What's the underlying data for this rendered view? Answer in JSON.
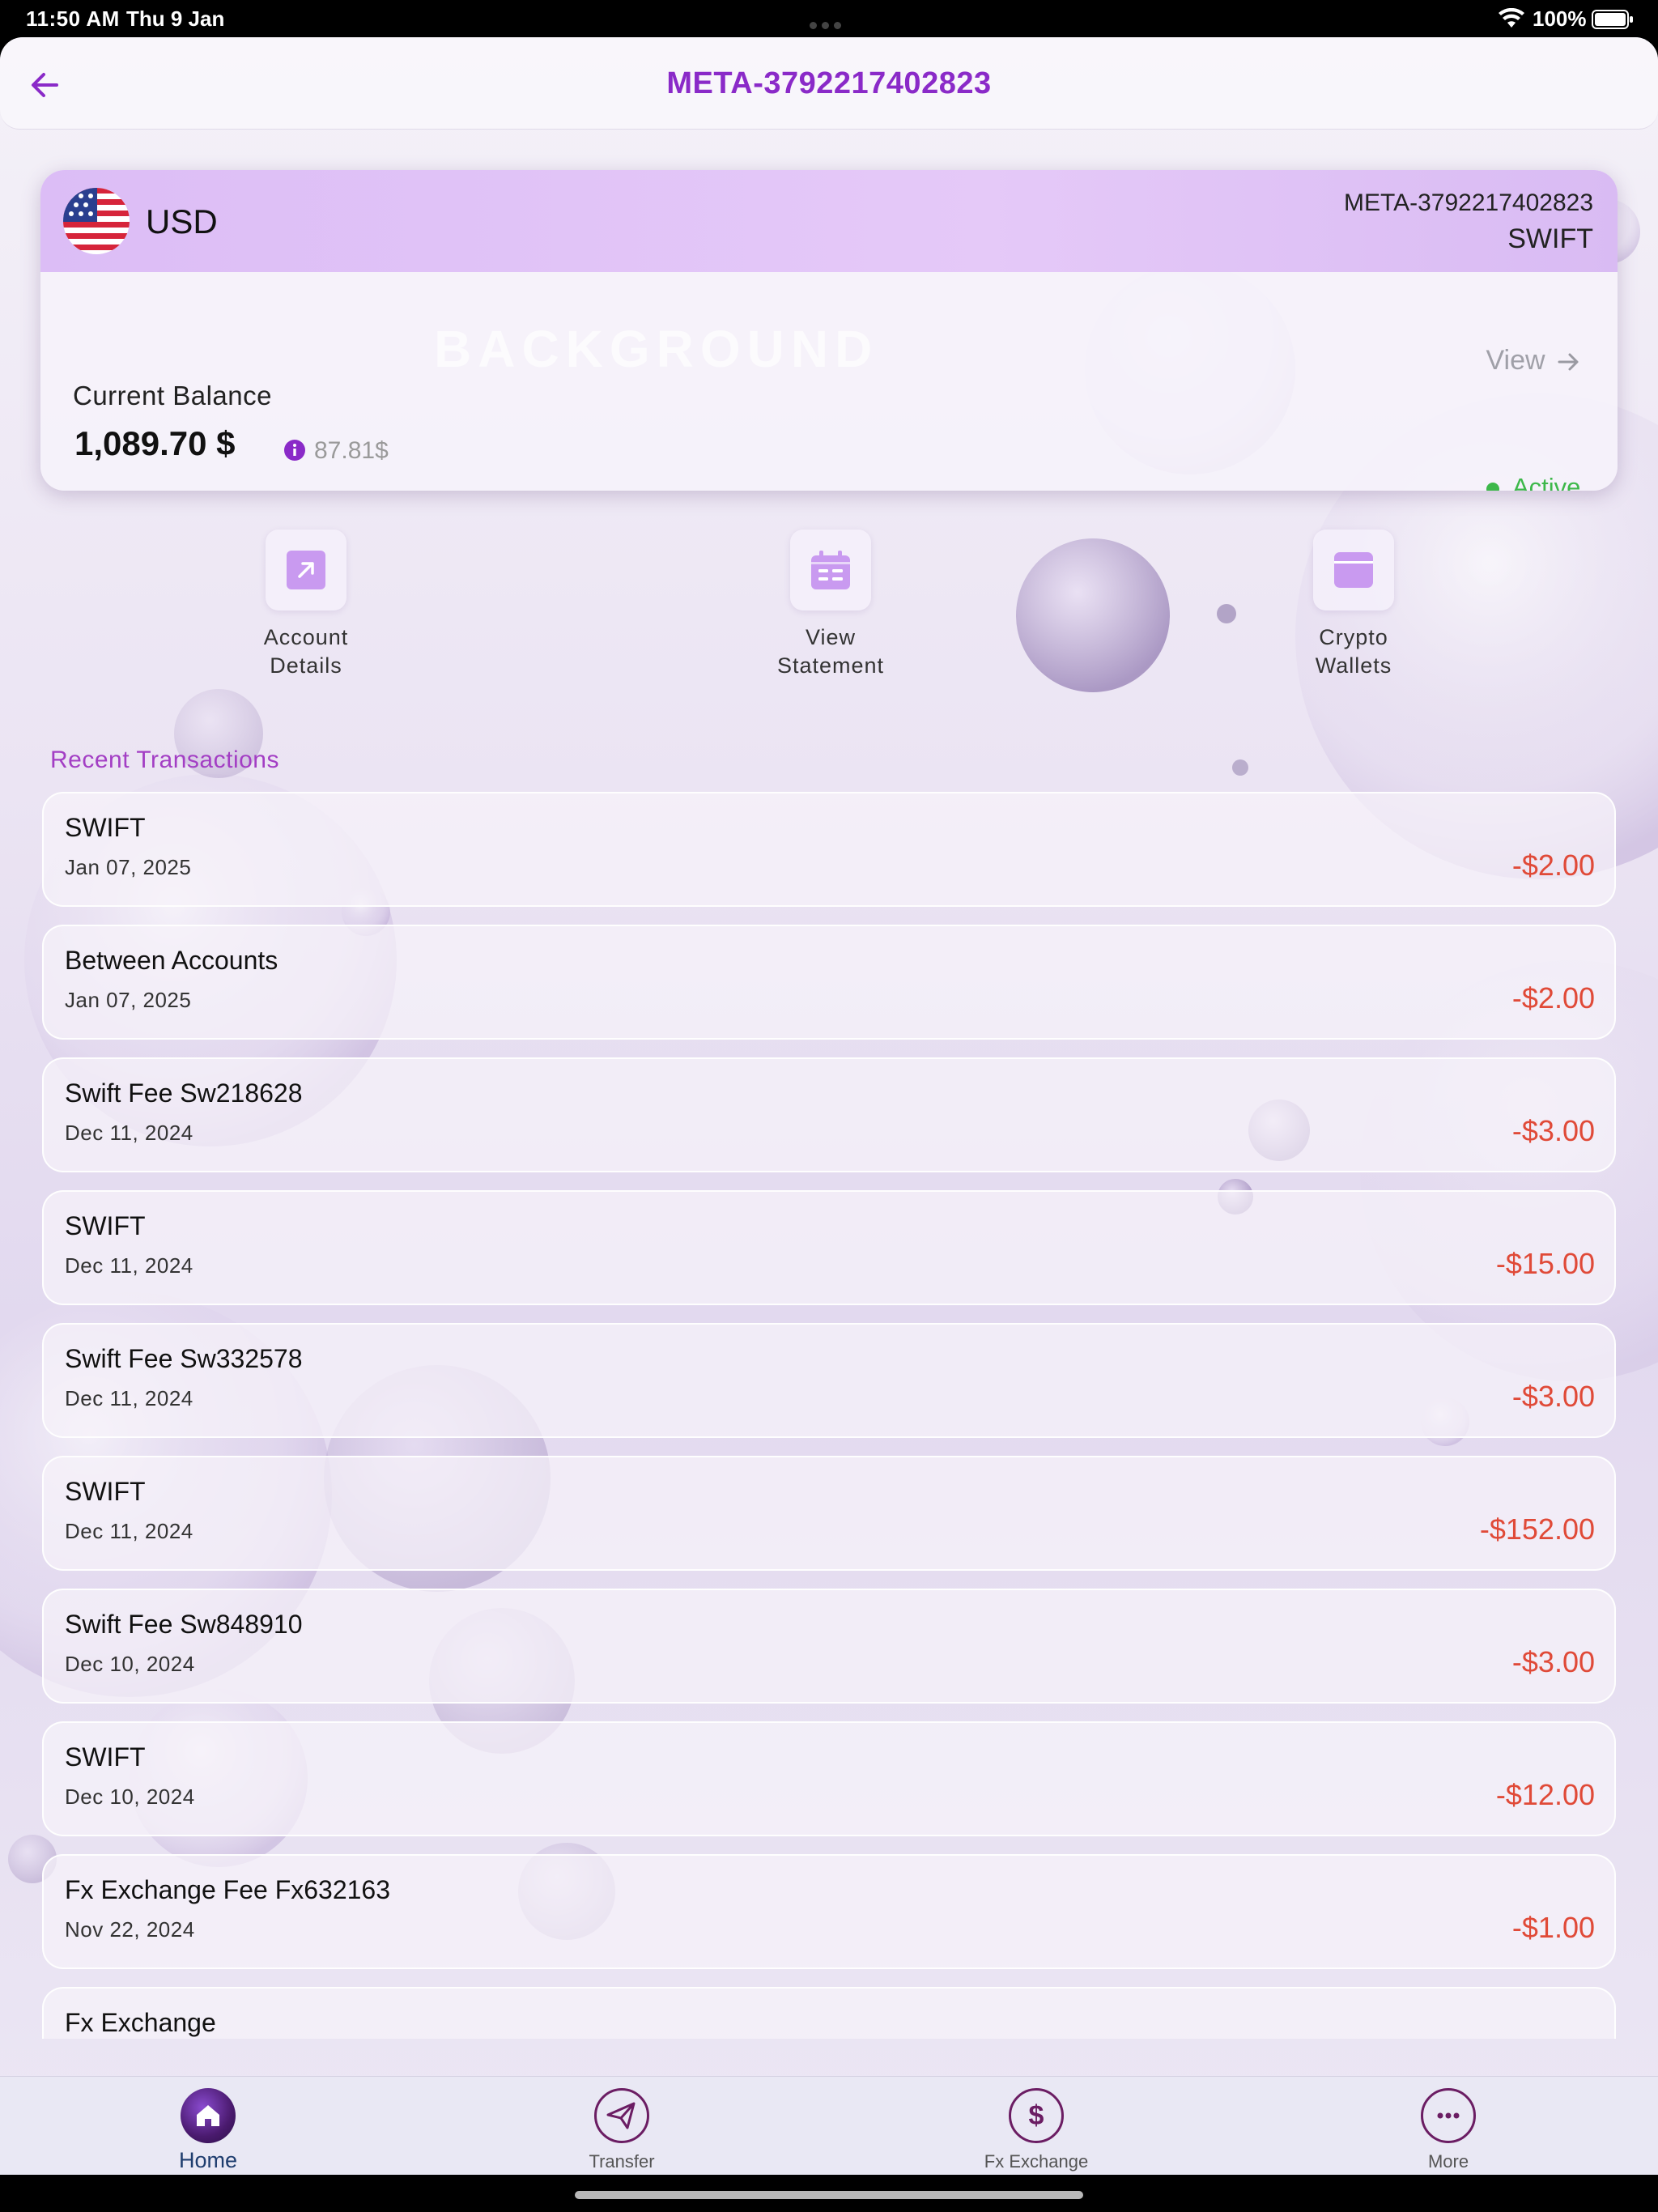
{
  "status_bar": {
    "time": "11:50 AM",
    "date": "Thu 9 Jan",
    "battery": "100%"
  },
  "header": {
    "title": "META-3792217402823"
  },
  "account_card": {
    "currency": "USD",
    "account_number": "META-3792217402823",
    "network": "SWIFT",
    "watermark": "BACKGROUND",
    "balance_label": "Current Balance",
    "balance_value": "1,089.70 $",
    "secondary_amount": "87.81$",
    "view_label": "View",
    "status": "Active",
    "status_color": "#3db84a",
    "header_color": "#e0c4f7"
  },
  "actions": [
    {
      "line1": "Account",
      "line2": "Details",
      "icon": "arrow-up-right-icon"
    },
    {
      "line1": "View",
      "line2": "Statement",
      "icon": "calendar-icon"
    },
    {
      "line1": "Crypto",
      "line2": "Wallets",
      "icon": "wallet-icon"
    }
  ],
  "recent": {
    "title": "Recent Transactions",
    "transactions": [
      {
        "name": "SWIFT",
        "date": "Jan 07, 2025",
        "amount": "-$2.00"
      },
      {
        "name": "Between Accounts",
        "date": "Jan 07, 2025",
        "amount": "-$2.00"
      },
      {
        "name": "Swift Fee Sw218628",
        "date": "Dec 11, 2024",
        "amount": "-$3.00"
      },
      {
        "name": "SWIFT",
        "date": "Dec 11, 2024",
        "amount": "-$15.00"
      },
      {
        "name": "Swift Fee Sw332578",
        "date": "Dec 11, 2024",
        "amount": "-$3.00"
      },
      {
        "name": "SWIFT",
        "date": "Dec 11, 2024",
        "amount": "-$152.00"
      },
      {
        "name": "Swift Fee Sw848910",
        "date": "Dec 10, 2024",
        "amount": "-$3.00"
      },
      {
        "name": "SWIFT",
        "date": "Dec 10, 2024",
        "amount": "-$12.00"
      },
      {
        "name": "Fx Exchange Fee Fx632163",
        "date": "Nov 22, 2024",
        "amount": "-$1.00"
      },
      {
        "name": "Fx Exchange",
        "date": "",
        "amount": ""
      }
    ]
  },
  "tab_bar": {
    "tabs": [
      {
        "label": "Home",
        "icon": "home-icon",
        "active": true
      },
      {
        "label": "Transfer",
        "icon": "paper-plane-icon",
        "active": false
      },
      {
        "label": "Fx Exchange",
        "icon": "dollar-icon",
        "active": false
      },
      {
        "label": "More",
        "icon": "more-icon",
        "active": false
      }
    ]
  },
  "colors": {
    "accent": "#8a2ac8",
    "debit": "#e04a38",
    "section_title": "#a33ec4"
  }
}
